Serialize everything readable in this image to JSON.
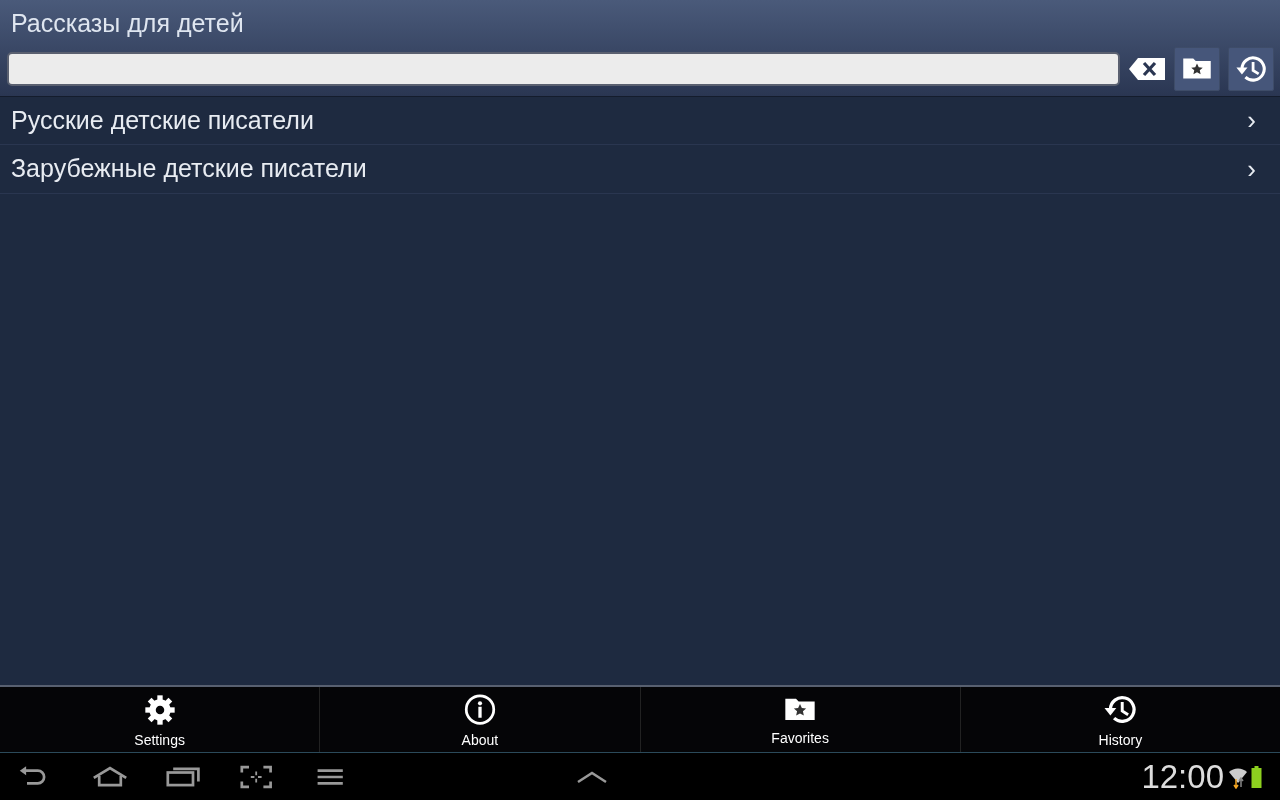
{
  "window": {
    "title": "Рассказы для детей"
  },
  "list": [
    {
      "label": "Русские детские писатели",
      "chevron": "›"
    },
    {
      "label": "Зарубежные детские писатели",
      "chevron": "›"
    }
  ],
  "bottom_tabs": [
    {
      "label": "Settings",
      "kind": "settings"
    },
    {
      "label": "About",
      "kind": "about"
    },
    {
      "label": "Favorites",
      "kind": "favorites"
    },
    {
      "label": "History",
      "kind": "history"
    }
  ],
  "status_bar": {
    "time": "12:00"
  }
}
